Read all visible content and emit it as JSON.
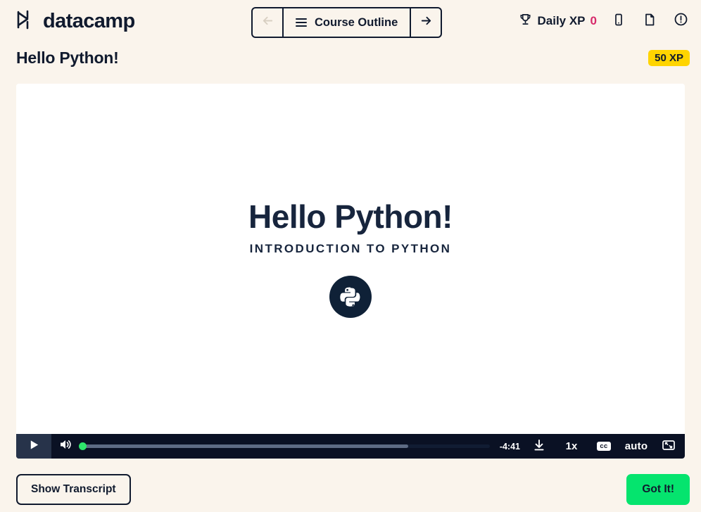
{
  "brand": {
    "name": "datacamp",
    "logo_icon": "datacamp-logo-icon"
  },
  "nav": {
    "back_icon": "arrow-left-icon",
    "forward_icon": "arrow-right-icon",
    "menu_icon": "hamburger-menu-icon",
    "outline_label": "Course Outline"
  },
  "header": {
    "xp_label": "Daily XP",
    "xp_value": "0",
    "trophy_icon": "trophy-icon",
    "mobile_icon": "mobile-device-icon",
    "document_icon": "document-icon",
    "info_icon": "info-circle-icon",
    "accent_pink": "#d6296a"
  },
  "title_row": {
    "title": "Hello Python!",
    "xp_badge": "50 XP",
    "badge_color": "#ffd400"
  },
  "slide": {
    "heading": "Hello Python!",
    "subheading": "INTRODUCTION TO PYTHON",
    "logo_icon": "python-logo-icon"
  },
  "player": {
    "play_icon": "play-icon",
    "volume_icon": "volume-on-icon",
    "time_remaining": "-4:41",
    "download_icon": "download-icon",
    "speed_label": "1x",
    "captions_label": "cc",
    "quality_label": "auto",
    "fullscreen_icon": "fullscreen-icon",
    "progress_percent": "0",
    "buffered_percent": "80",
    "scrubber_color": "#2ee66b"
  },
  "footer": {
    "transcript_label": "Show Transcript",
    "primary_label": "Got It!",
    "primary_color": "#05e46e"
  }
}
